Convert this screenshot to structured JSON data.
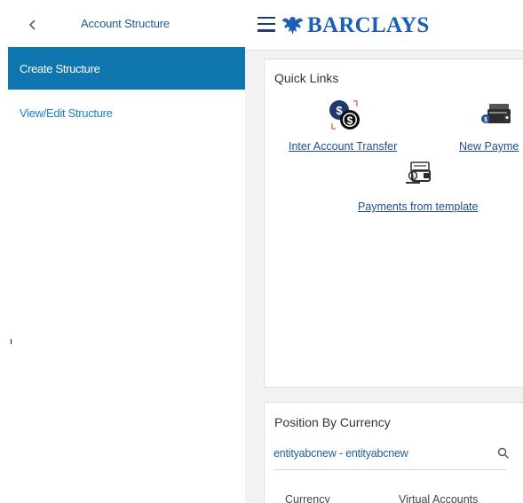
{
  "sidebar": {
    "title": "Account Structure",
    "items": [
      {
        "label": "Create Structure",
        "active": true
      },
      {
        "label": "View/Edit Structure",
        "active": false
      }
    ]
  },
  "header": {
    "brand": "BARCLAYS",
    "brand_color": "#1a5fb4"
  },
  "quick_links": {
    "title": "Quick Links",
    "links": [
      {
        "label": "Inter Account Transfer",
        "icon": "currency-exchange-icon"
      },
      {
        "label": "New Payme",
        "icon": "wallet-payment-icon"
      },
      {
        "label": "Payments from template",
        "icon": "payment-template-icon"
      }
    ]
  },
  "position_by_currency": {
    "title": "Position By Currency",
    "entity": "entityabcnew - entityabcnew",
    "columns": [
      "Currency",
      "Virtual Accounts"
    ]
  },
  "colors": {
    "active_item_bg": "#0f76b0",
    "link": "#1c7ec2"
  }
}
